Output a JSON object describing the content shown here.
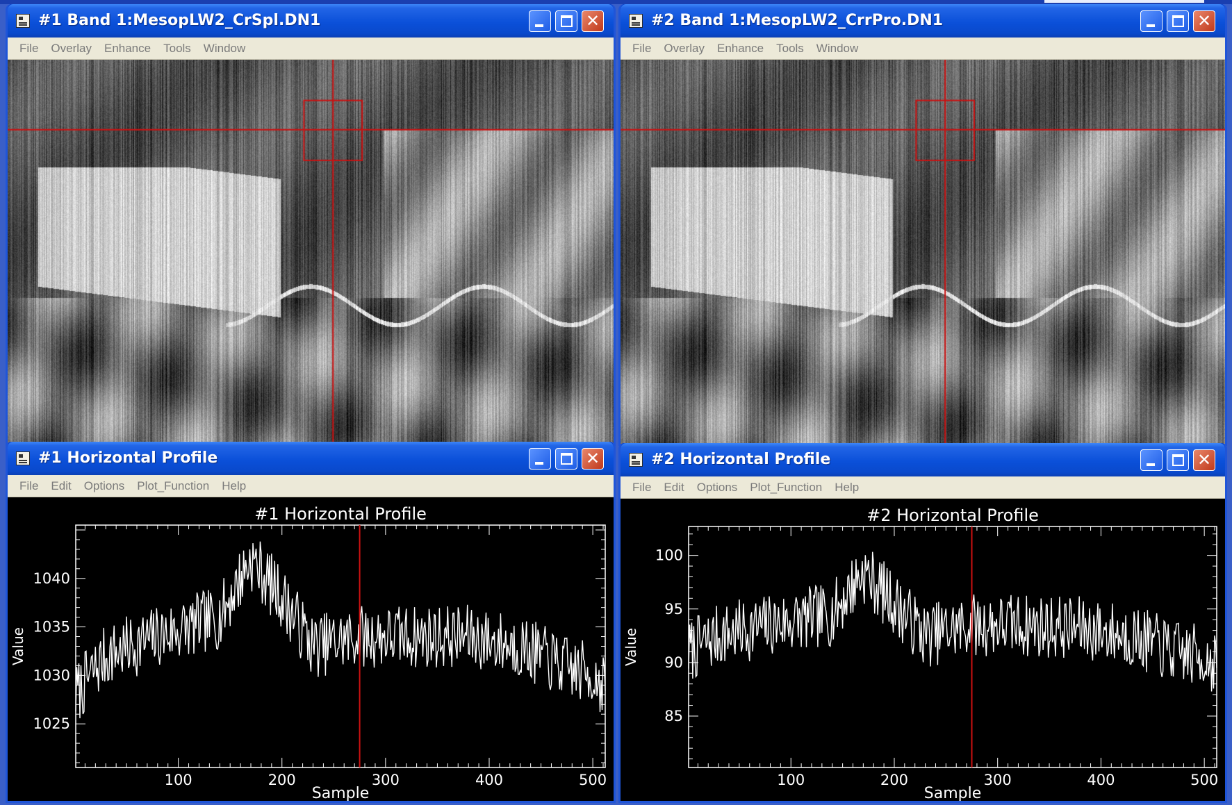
{
  "windows": [
    {
      "id": "img1",
      "type": "image",
      "title": "#1 Band 1:MesopLW2_CrSpl.DN1",
      "menu": [
        "File",
        "Overlay",
        "Enhance",
        "Tools",
        "Window"
      ]
    },
    {
      "id": "img2",
      "type": "image",
      "title": "#2 Band 1:MesopLW2_CrrPro.DN1",
      "menu": [
        "File",
        "Overlay",
        "Enhance",
        "Tools",
        "Window"
      ]
    },
    {
      "id": "prof1",
      "type": "profile",
      "title": "#1 Horizontal Profile",
      "menu": [
        "File",
        "Edit",
        "Options",
        "Plot_Function",
        "Help"
      ]
    },
    {
      "id": "prof2",
      "type": "profile",
      "title": "#2 Horizontal Profile",
      "menu": [
        "File",
        "Edit",
        "Options",
        "Plot_Function",
        "Help"
      ]
    }
  ],
  "icons": {
    "system": "window-system-icon",
    "minimize": "minimize-icon",
    "maximize": "maximize-icon",
    "close": "close-icon",
    "close_glyph": "✕"
  },
  "colors": {
    "titlebar": "#0b50d9",
    "menubar": "#ece9d8",
    "plot_bg": "#000000",
    "plot_line": "#ffffff",
    "cursor": "#cc1111"
  },
  "images": {
    "zoom_box": [
      0.489,
      0.106,
      0.585,
      0.262
    ],
    "cursor_fraction": [
      0.537,
      0.182
    ]
  },
  "chart_data": [
    {
      "type": "line",
      "title": "#1 Horizontal Profile",
      "xlabel": "Sample",
      "ylabel": "Value",
      "xlim": [
        1,
        512
      ],
      "ylim": [
        1020.5,
        1045.5
      ],
      "xticks": [
        100,
        200,
        300,
        400,
        500
      ],
      "yticks": [
        1025,
        1030,
        1035,
        1040
      ],
      "cursor_x": 275,
      "profile_shape": [
        [
          1,
          1028
        ],
        [
          30,
          1032
        ],
        [
          80,
          1034
        ],
        [
          140,
          1036
        ],
        [
          170,
          1042
        ],
        [
          200,
          1038
        ],
        [
          230,
          1033
        ],
        [
          275,
          1034
        ],
        [
          320,
          1034
        ],
        [
          380,
          1034
        ],
        [
          430,
          1033
        ],
        [
          470,
          1031
        ],
        [
          500,
          1030
        ],
        [
          512,
          1029
        ]
      ],
      "noise_amplitude": 3.3
    },
    {
      "type": "line",
      "title": "#2 Horizontal Profile",
      "xlabel": "Sample",
      "ylabel": "Value",
      "xlim": [
        1,
        512
      ],
      "ylim": [
        80.2,
        102.7
      ],
      "xticks": [
        100,
        200,
        300,
        400,
        500
      ],
      "yticks": [
        85,
        90,
        95,
        100
      ],
      "cursor_x": 275,
      "profile_shape": [
        [
          1,
          91
        ],
        [
          30,
          92.5
        ],
        [
          80,
          93.5
        ],
        [
          140,
          94.5
        ],
        [
          170,
          98.5
        ],
        [
          200,
          95.5
        ],
        [
          230,
          92.5
        ],
        [
          275,
          93.5
        ],
        [
          320,
          93.5
        ],
        [
          380,
          93.2
        ],
        [
          430,
          92.5
        ],
        [
          470,
          91
        ],
        [
          500,
          90.5
        ],
        [
          512,
          90
        ]
      ],
      "noise_amplitude": 3.0
    }
  ]
}
